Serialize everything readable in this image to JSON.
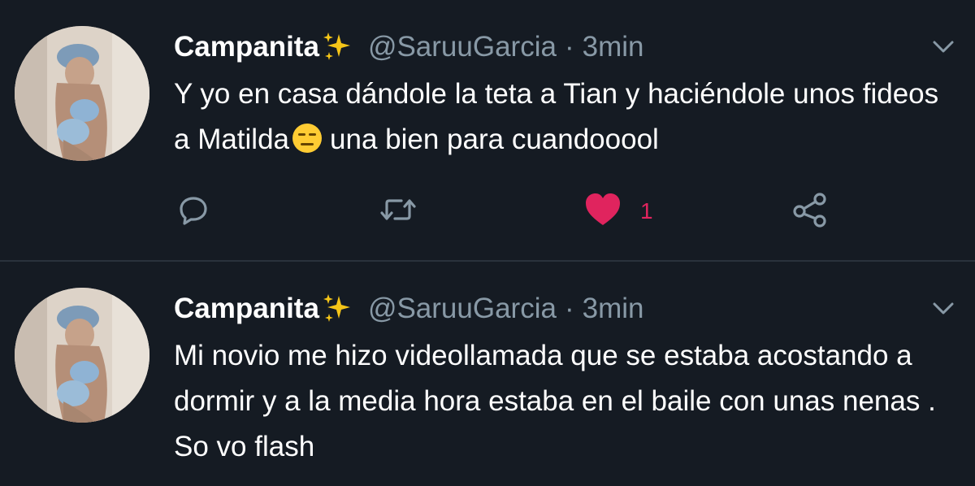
{
  "colors": {
    "background": "#151b23",
    "text_primary": "#ffffff",
    "text_secondary": "#8899a6",
    "like_active": "#e0245e",
    "divider": "#2a323c"
  },
  "tweets": [
    {
      "display_name": "Campanita",
      "name_emoji": "sparkles-icon",
      "handle": "@SaruuGarcia",
      "separator": "·",
      "time": "3min",
      "text_before_emoji": "Y yo en casa dándole la teta a Tian y haciéndole unos fideos a Matilda",
      "inline_emoji": "expressionless-face-icon",
      "text_after_emoji": "una bien para cuandooool",
      "like_count": "1",
      "liked": true,
      "actions": [
        "reply-icon",
        "retweet-icon",
        "like-icon",
        "share-icon"
      ]
    },
    {
      "display_name": "Campanita",
      "name_emoji": "sparkles-icon",
      "handle": "@SaruuGarcia",
      "separator": "·",
      "time": "3min",
      "text": "Mi novio me hizo videollamada que se estaba acostando a dormir y a la media hora estaba en el baile con unas nenas . So vo flash"
    }
  ]
}
